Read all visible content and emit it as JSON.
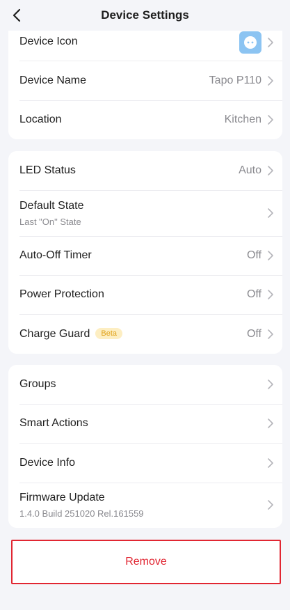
{
  "header": {
    "title": "Device Settings"
  },
  "card1": {
    "device_icon_label": "Device Icon",
    "device_name_label": "Device Name",
    "device_name_value": "Tapo P110",
    "location_label": "Location",
    "location_value": "Kitchen"
  },
  "card2": {
    "led_label": "LED Status",
    "led_value": "Auto",
    "default_state_label": "Default State",
    "default_state_sub": "Last \"On\" State",
    "auto_off_label": "Auto-Off Timer",
    "auto_off_value": "Off",
    "power_protection_label": "Power Protection",
    "power_protection_value": "Off",
    "charge_guard_label": "Charge Guard",
    "charge_guard_badge": "Beta",
    "charge_guard_value": "Off"
  },
  "card3": {
    "groups_label": "Groups",
    "smart_actions_label": "Smart Actions",
    "device_info_label": "Device Info",
    "firmware_label": "Firmware Update",
    "firmware_sub": "1.4.0 Build 251020 Rel.161559"
  },
  "remove_label": "Remove",
  "colors": {
    "accent_red": "#e12632",
    "beta_bg": "#fdeec2",
    "beta_text": "#e0a21b",
    "icon_bg": "#8cc4f2",
    "background": "#f4f5f9"
  }
}
